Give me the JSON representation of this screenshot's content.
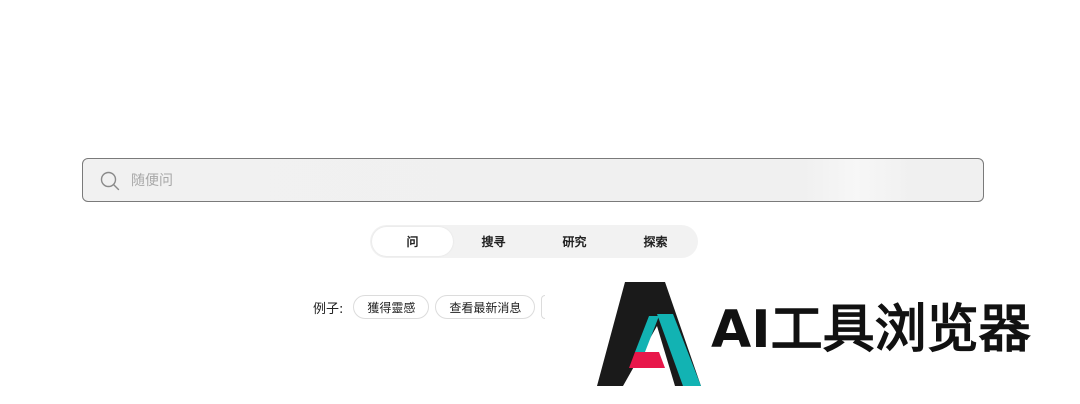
{
  "search": {
    "placeholder": "随便问",
    "value": ""
  },
  "modes": {
    "tabs": [
      {
        "label": "问",
        "active": true
      },
      {
        "label": "搜寻",
        "active": false
      },
      {
        "label": "研究",
        "active": false
      },
      {
        "label": "探索",
        "active": false
      }
    ]
  },
  "examples": {
    "label": "例子:",
    "chips": [
      "獲得靈感",
      "查看最新消息"
    ]
  },
  "watermark": {
    "text": "AI工具浏览器",
    "colors": {
      "dark": "#1a1a1a",
      "teal": "#12b3b3",
      "red": "#e8174a"
    }
  },
  "icons": {
    "search": "search-icon",
    "logo": "watermark-logo-icon"
  }
}
